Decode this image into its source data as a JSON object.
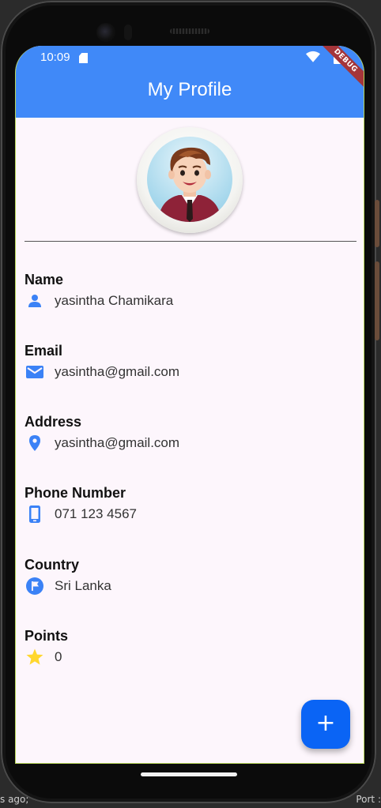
{
  "desktop": {
    "left_text": "s ago;",
    "right_text": "Port :"
  },
  "status_bar": {
    "time": "10:09"
  },
  "debug_banner": "DEBUG",
  "app_bar": {
    "title": "My Profile"
  },
  "fields": [
    {
      "label": "Name",
      "value": "yasintha Chamikara",
      "icon": "person-icon"
    },
    {
      "label": "Email",
      "value": "yasintha@gmail.com",
      "icon": "email-icon"
    },
    {
      "label": "Address",
      "value": "yasintha@gmail.com",
      "icon": "location-pin-icon"
    },
    {
      "label": "Phone Number",
      "value": "071 123 4567",
      "icon": "phone-icon"
    },
    {
      "label": "Country",
      "value": "Sri Lanka",
      "icon": "flag-icon"
    },
    {
      "label": "Points",
      "value": "0",
      "icon": "star-icon"
    }
  ],
  "fab": {
    "label": "+"
  },
  "colors": {
    "app_bar": "#4089f8",
    "icon_blue": "#3b82f6",
    "star": "#ffd72e",
    "fab": "#0a64f5",
    "background": "#fdf6fc"
  }
}
